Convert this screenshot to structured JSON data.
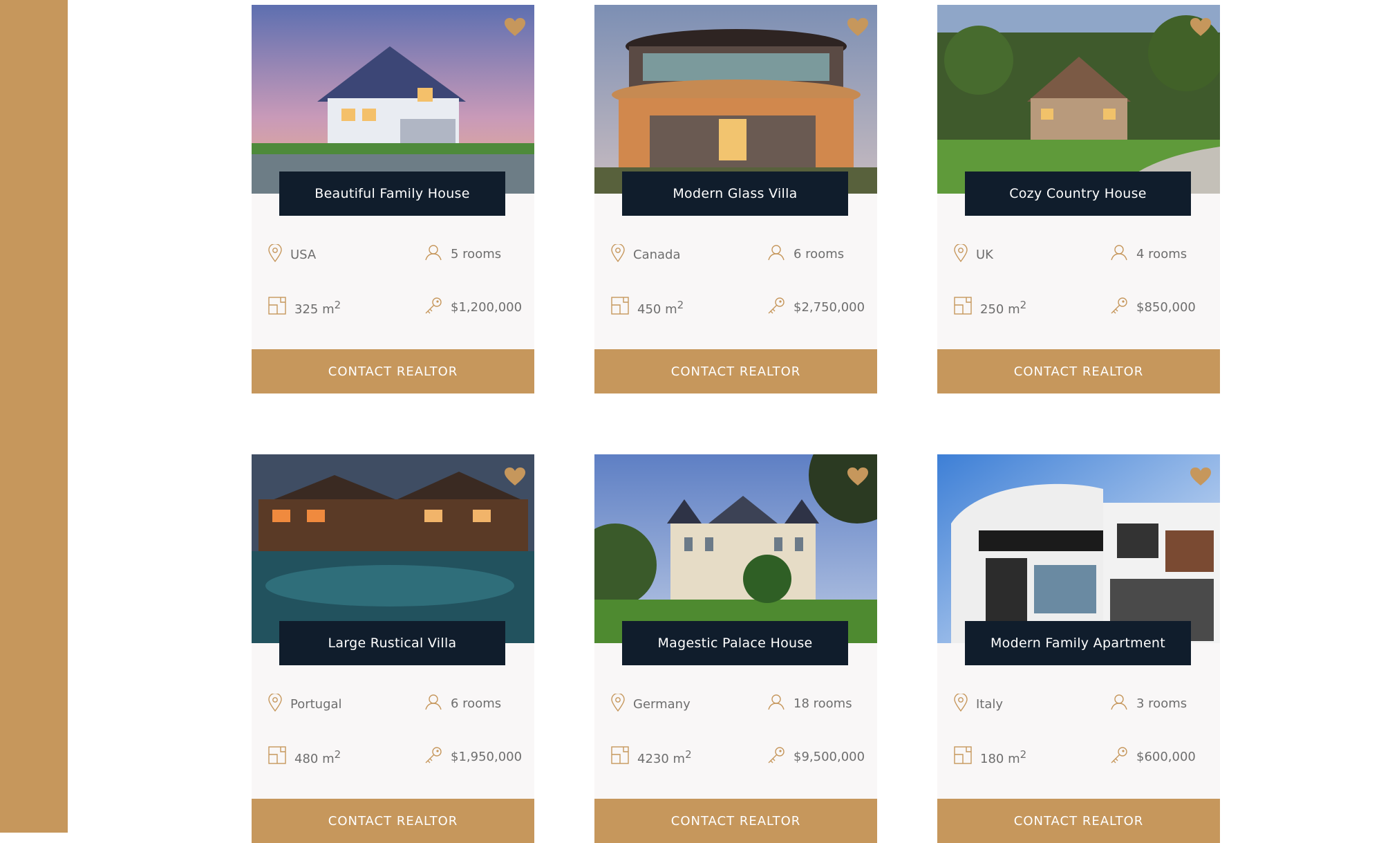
{
  "colors": {
    "accent": "#c6975c",
    "dark": "#101d2c",
    "card_bg": "#f9f7f7",
    "text_muted": "#6e6e6e"
  },
  "icons": {
    "favorite": "heart-icon",
    "location": "map-pin-icon",
    "rooms": "user-icon",
    "area": "area-icon",
    "price": "key-icon"
  },
  "houses": [
    {
      "name": "Beautiful Family House",
      "location": "USA",
      "rooms": "5 rooms",
      "area": "325 m",
      "area_unit_sup": "2",
      "price": "$1,200,000",
      "cta": "CONTACT REALTOR"
    },
    {
      "name": "Modern Glass Villa",
      "location": "Canada",
      "rooms": "6 rooms",
      "area": "450 m",
      "area_unit_sup": "2",
      "price": "$2,750,000",
      "cta": "CONTACT REALTOR"
    },
    {
      "name": "Cozy Country House",
      "location": "UK",
      "rooms": "4 rooms",
      "area": "250 m",
      "area_unit_sup": "2",
      "price": "$850,000",
      "cta": "CONTACT REALTOR"
    },
    {
      "name": "Large Rustical Villa",
      "location": "Portugal",
      "rooms": "6 rooms",
      "area": "480 m",
      "area_unit_sup": "2",
      "price": "$1,950,000",
      "cta": "CONTACT REALTOR"
    },
    {
      "name": "Magestic Palace House",
      "location": "Germany",
      "rooms": "18 rooms",
      "area": "4230 m",
      "area_unit_sup": "2",
      "price": "$9,500,000",
      "cta": "CONTACT REALTOR"
    },
    {
      "name": "Modern Family Apartment",
      "location": "Italy",
      "rooms": "3 rooms",
      "area": "180 m",
      "area_unit_sup": "2",
      "price": "$600,000",
      "cta": "CONTACT REALTOR"
    }
  ]
}
